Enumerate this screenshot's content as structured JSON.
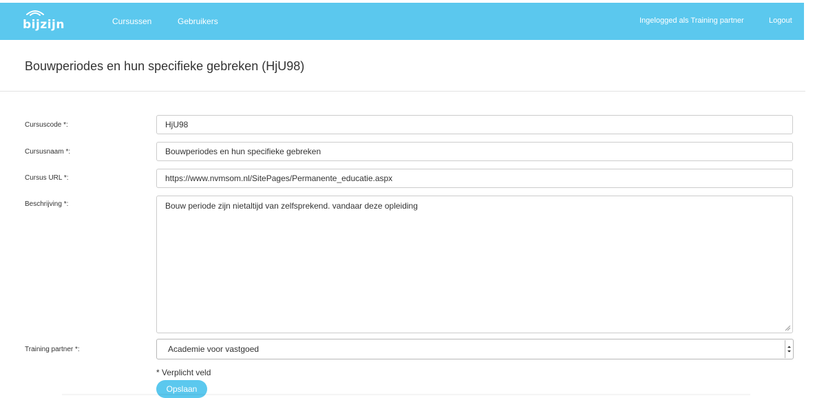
{
  "app": {
    "logo_text": "bijzijn",
    "brand_color": "#5bc8ee"
  },
  "nav": {
    "items": [
      {
        "label": "Cursussen"
      },
      {
        "label": "Gebruikers"
      }
    ],
    "user_status": "Ingelogged als Training partner",
    "logout_label": "Logout"
  },
  "page": {
    "title": "Bouwperiodes en hun specifieke gebreken (HjU98)"
  },
  "form": {
    "course_code": {
      "label": "Cursuscode *:",
      "value": "HjU98"
    },
    "course_name": {
      "label": "Cursusnaam *:",
      "value": "Bouwperiodes en hun specifieke gebreken"
    },
    "course_url": {
      "label": "Cursus URL *:",
      "value": "https://www.nvmsom.nl/SitePages/Permanente_educatie.aspx"
    },
    "description": {
      "label": "Beschrijving *:",
      "value": "Bouw periode zijn nietaltijd van zelfsprekend. vandaar deze opleiding"
    },
    "training_partner": {
      "label": "Training partner *:",
      "selected": "Academie voor vastgoed"
    },
    "required_note": "* Verplicht veld",
    "save_label": "Opslaan"
  },
  "icons": {
    "logo": "wifi-arc-icon",
    "select_arrow": "chevron-down-icon",
    "resize": "resize-handle-icon"
  }
}
